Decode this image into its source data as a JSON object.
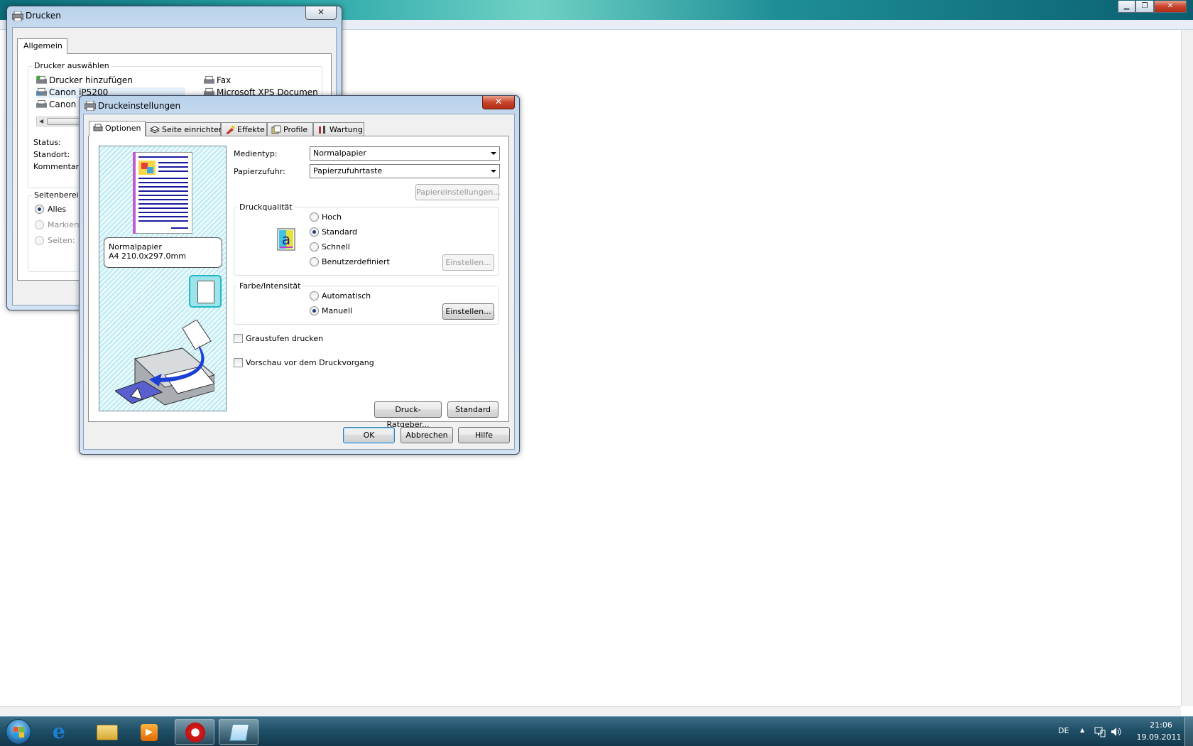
{
  "background_window": {
    "buttons": {
      "minimize": "▁",
      "maximize": "❐",
      "close": "✕"
    }
  },
  "print_dialog": {
    "title": "Drucken",
    "close": "✕",
    "tab_general": "Allgemein",
    "select_printer_label": "Drucker auswählen",
    "printers": [
      {
        "name": "Drucker hinzufügen",
        "icon": "add-printer-icon"
      },
      {
        "name": "Fax",
        "icon": "fax-printer-icon"
      },
      {
        "name": "Canon iP5200",
        "icon": "printer-icon"
      },
      {
        "name": "Microsoft XPS Documen",
        "icon": "printer-icon"
      },
      {
        "name": "Canon i",
        "icon": "printer-icon"
      }
    ],
    "status_label": "Status:",
    "location_label": "Standort:",
    "comment_label": "Kommentar:",
    "page_range_label": "Seitenbereich",
    "range_all": "Alles",
    "range_selection": "Markierung",
    "range_pages": "Seiten:"
  },
  "settings_dialog": {
    "title": "Druckeinstellungen",
    "close": "✕",
    "tabs": [
      {
        "label": "Optionen",
        "icon": "options-icon",
        "active": true
      },
      {
        "label": "Seite einrichten",
        "icon": "page-setup-icon",
        "active": false
      },
      {
        "label": "Effekte",
        "icon": "effects-icon",
        "active": false
      },
      {
        "label": "Profile",
        "icon": "profile-icon",
        "active": false
      },
      {
        "label": "Wartung",
        "icon": "maintenance-icon",
        "active": false
      }
    ],
    "preview": {
      "media_name": "Normalpapier",
      "paper_size": "A4 210.0x297.0mm"
    },
    "media_type_label": "Medientyp:",
    "media_type_value": "Normalpapier",
    "paper_source_label": "Papierzufuhr:",
    "paper_source_value": "Papierzufuhrtaste",
    "paper_settings_button": "Papiereinstellungen...",
    "quality": {
      "label": "Druckqualität",
      "options": [
        "Hoch",
        "Standard",
        "Schnell",
        "Benutzerdefiniert"
      ],
      "selected": "Standard",
      "settings_button": "Einstellen..."
    },
    "color": {
      "label": "Farbe/Intensität",
      "options": [
        "Automatisch",
        "Manuell"
      ],
      "selected": "Manuell",
      "settings_button": "Einstellen..."
    },
    "grayscale_label": "Graustufen drucken",
    "preview_before_label": "Vorschau vor dem Druckvorgang",
    "advisor_button": "Druck-Ratgeber...",
    "defaults_button": "Standard",
    "ok_button": "OK",
    "cancel_button": "Abbrechen",
    "help_button": "Hilfe"
  },
  "taskbar": {
    "language": "DE",
    "time": "21:06",
    "date": "19.09.2011",
    "tray_up": "▲",
    "apps": [
      "start-orb",
      "internet-explorer",
      "file-explorer",
      "media-player",
      "opera",
      "notepad-editor"
    ]
  },
  "colors": {
    "accent": "#1d3f74",
    "preview_bg": "#bfeaf0",
    "close_red": "#c9442c"
  }
}
